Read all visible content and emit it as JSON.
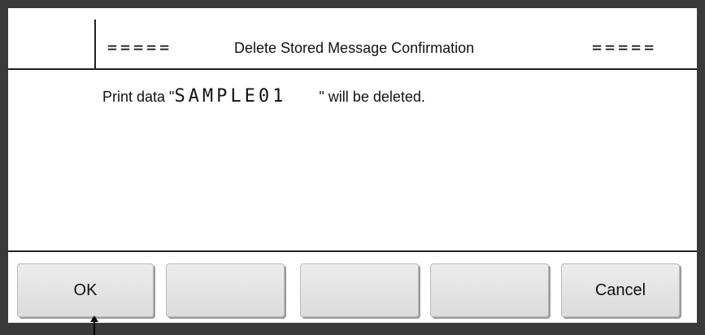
{
  "dialog": {
    "title_left_deco": "=====",
    "title": "Delete Stored Message Confirmation",
    "title_right_deco": "=====",
    "message_prefix": "Print data \"",
    "message_name": "SAMPLE01",
    "message_suffix": "        \" will be deleted."
  },
  "buttons": {
    "ok": "OK",
    "blank1": "",
    "blank2": "",
    "blank3": "",
    "cancel": "Cancel"
  },
  "colors": {
    "background": "#3a3a3a",
    "panel": "#ffffff",
    "button": "#e4e4e4"
  },
  "pointer": "arrow-pointer-icon"
}
